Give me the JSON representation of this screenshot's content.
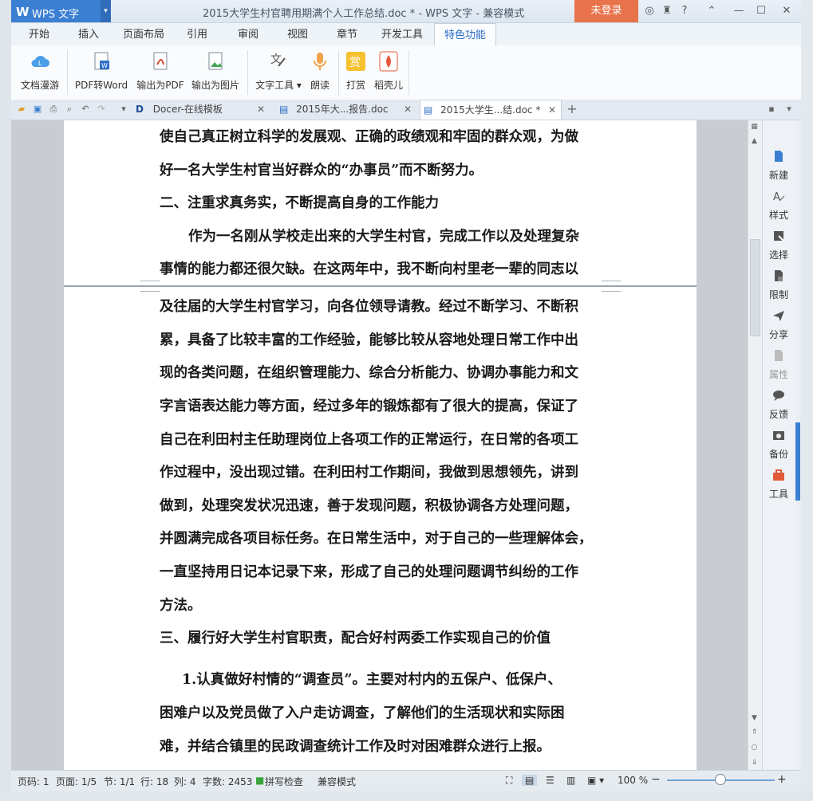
{
  "app": {
    "logo_text": "WPS 文字",
    "title": "2015大学生村官聘用期满个人工作总结.doc * - WPS 文字 - 兼容模式",
    "login": "未登录"
  },
  "menu": [
    "开始",
    "插入",
    "页面布局",
    "引用",
    "审阅",
    "视图",
    "章节",
    "开发工具",
    "特色功能"
  ],
  "ribbon": [
    {
      "label": "文档漫游",
      "icon": "cloud-roam-icon"
    },
    {
      "label": "PDF转Word",
      "icon": "pdf-to-word-icon"
    },
    {
      "label": "输出为PDF",
      "icon": "export-pdf-icon"
    },
    {
      "label": "输出为图片",
      "icon": "export-image-icon"
    },
    {
      "label": "文字工具",
      "icon": "text-tools-icon"
    },
    {
      "label": "朗读",
      "icon": "read-aloud-icon"
    },
    {
      "label": "打赏",
      "icon": "reward-icon"
    },
    {
      "label": "稻壳儿",
      "icon": "docer-icon"
    }
  ],
  "tabs": [
    {
      "label": "Docer-在线模板"
    },
    {
      "label": "2015年大...报告.doc"
    },
    {
      "label": "2015大学生...结.doc *"
    }
  ],
  "document": {
    "lines": [
      "使自己真正树立科学的发展观、正确的政绩观和牢固的群众观，为做",
      "好一名大学生村官当好群众的“办事员”而不断努力。",
      "二、注重求真务实，不断提高自身的工作能力",
      "作为一名刚从学校走出来的大学生村官，完成工作以及处理复杂",
      "事情的能力都还很欠缺。在这两年中，我不断向村里老一辈的同志以",
      "及往届的大学生村官学习，向各位领导请教。经过不断学习、不断积",
      "累，具备了比较丰富的工作经验，能够比较从容地处理日常工作中出",
      "现的各类问题，在组织管理能力、综合分析能力、协调办事能力和文",
      "字言语表达能力等方面，经过多年的锻炼都有了很大的提高，保证了",
      "自己在利田村主任助理岗位上各项工作的正常运行，在日常的各项工",
      "作过程中，没出现过错。在利田村工作期间，我做到思想领先，讲到",
      "做到，处理突发状况迅速，善于发现问题，积极协调各方处理问题，",
      "并圆满完成各项目标任务。在日常生活中，对于自己的一些理解体会，",
      "一直坚持用日记本记录下来，形成了自己的处理问题调节纠纷的工作",
      "方法。",
      "三、履行好大学生村官职责，配合好村两委工作实现自己的价值",
      "1.认真做好村情的“调查员”。主要对村内的五保户、低保户、",
      "困难户以及党员做了入户走访调查，了解他们的生活现状和实际困",
      "难，并结合镇里的民政调查统计工作及时对困难群众进行上报。"
    ]
  },
  "right_panel": [
    {
      "label": "新建",
      "icon": "new-doc-icon"
    },
    {
      "label": "样式",
      "icon": "style-icon"
    },
    {
      "label": "选择",
      "icon": "select-icon"
    },
    {
      "label": "限制",
      "icon": "restrict-icon"
    },
    {
      "label": "分享",
      "icon": "share-icon"
    },
    {
      "label": "属性",
      "icon": "properties-icon"
    },
    {
      "label": "反馈",
      "icon": "feedback-icon"
    },
    {
      "label": "备份",
      "icon": "backup-icon"
    },
    {
      "label": "工具",
      "icon": "toolbox-icon"
    }
  ],
  "status": {
    "page": "页码: 1",
    "pages": "页面: 1/5",
    "section": "节: 1/1",
    "row": "行: 18",
    "col": "列: 4",
    "words": "字数: 2453",
    "spell": "拼写检查",
    "compat": "兼容模式",
    "zoom": "100 %"
  },
  "colors": {
    "accent": "#3b7fd2",
    "login": "#e8734a"
  }
}
